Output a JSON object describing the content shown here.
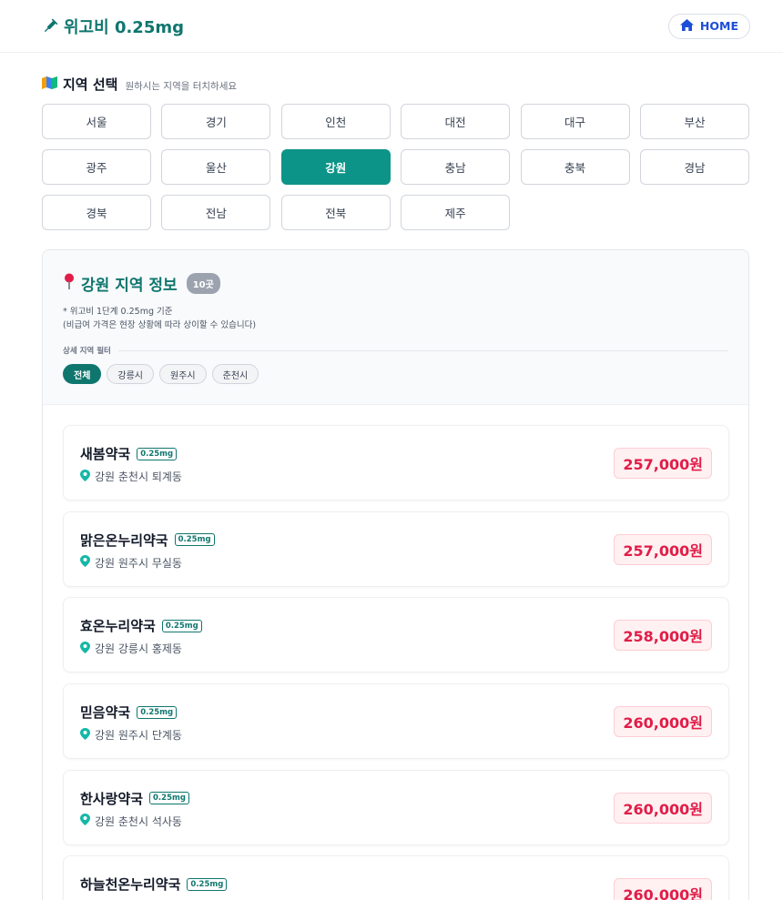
{
  "header": {
    "title": "위고비 0.25mg",
    "home_label": "HOME"
  },
  "region_section": {
    "title": "지역 선택",
    "hint": "원하시는 지역을 터치하세요"
  },
  "regions": [
    {
      "label": "서울"
    },
    {
      "label": "경기"
    },
    {
      "label": "인천"
    },
    {
      "label": "대전"
    },
    {
      "label": "대구"
    },
    {
      "label": "부산"
    },
    {
      "label": "광주"
    },
    {
      "label": "울산"
    },
    {
      "label": "강원",
      "active": true
    },
    {
      "label": "충남"
    },
    {
      "label": "충북"
    },
    {
      "label": "경남"
    },
    {
      "label": "경북"
    },
    {
      "label": "전남"
    },
    {
      "label": "전북"
    },
    {
      "label": "제주"
    }
  ],
  "panel": {
    "title": "강원 지역 정보",
    "count": "10곳",
    "note_line1": "* 위고비 1단계 0.25mg 기준",
    "note_line2": "(비급여 가격은 현장 상황에 따라 상이할 수 있습니다)",
    "filter_label": "상세 지역 필터",
    "chips": [
      {
        "label": "전체",
        "active": true
      },
      {
        "label": "강릉시"
      },
      {
        "label": "원주시"
      },
      {
        "label": "춘천시"
      }
    ]
  },
  "pharmacies": [
    {
      "name": "새봄약국",
      "dose": "0.25mg",
      "address": "강원 춘천시 퇴계동",
      "price": "257,000원"
    },
    {
      "name": "맑은온누리약국",
      "dose": "0.25mg",
      "address": "강원 원주시 무실동",
      "price": "257,000원"
    },
    {
      "name": "효온누리약국",
      "dose": "0.25mg",
      "address": "강원 강릉시 홍제동",
      "price": "258,000원"
    },
    {
      "name": "믿음약국",
      "dose": "0.25mg",
      "address": "강원 원주시 단계동",
      "price": "260,000원"
    },
    {
      "name": "한사랑약국",
      "dose": "0.25mg",
      "address": "강원 춘천시 석사동",
      "price": "260,000원"
    },
    {
      "name": "하늘천온누리약국",
      "dose": "0.25mg",
      "address": "",
      "price": "260,000원"
    }
  ],
  "icons": {
    "brand": "syringe-icon",
    "home": "home-icon",
    "region": "map-icon",
    "panel": "pin-icon",
    "address": "location-icon"
  },
  "colors": {
    "accent": "#0f766e",
    "active_region": "#0d9488",
    "price": "#e11d48",
    "home": "#1d4ed8"
  }
}
